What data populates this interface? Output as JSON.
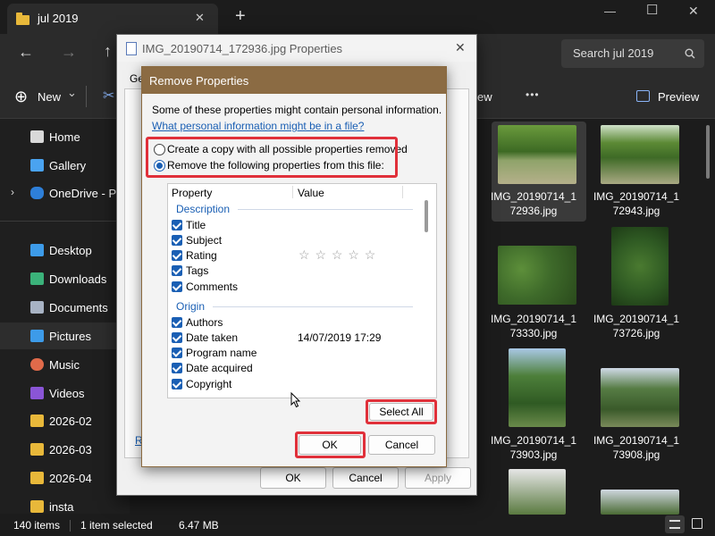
{
  "window": {
    "tab_title": "jul 2019",
    "new_tab": "+",
    "close_tab": "✕",
    "minimize": "—",
    "maximize": "☐",
    "close": "✕"
  },
  "address": {
    "back": "←",
    "forward": "→",
    "up": "↑",
    "search_placeholder": "Search jul 2019"
  },
  "toolbar": {
    "new_label": "New",
    "new_chevron": "⌄",
    "more": "•••",
    "preview_label": "Preview",
    "view_label": "ew"
  },
  "sidebar": {
    "items": [
      {
        "label": "Home",
        "color": "#d9d9d9"
      },
      {
        "label": "Gallery",
        "color": "#4aa3f0"
      },
      {
        "label": "OneDrive - Per",
        "color": "#2e7fd8"
      },
      {
        "label": "Desktop",
        "color": "#3d9be9"
      },
      {
        "label": "Downloads",
        "color": "#3bb27a"
      },
      {
        "label": "Documents",
        "color": "#a8b3c4"
      },
      {
        "label": "Pictures",
        "color": "#3d9be9"
      },
      {
        "label": "Music",
        "color": "#e06a4a"
      },
      {
        "label": "Videos",
        "color": "#8a55d6"
      },
      {
        "label": "2026-02",
        "color": "#e8b83a"
      },
      {
        "label": "2026-03",
        "color": "#e8b83a"
      },
      {
        "label": "2026-04",
        "color": "#e8b83a"
      },
      {
        "label": "insta",
        "color": "#e8b83a"
      }
    ]
  },
  "files": [
    {
      "line1": "IMG_20190714_1",
      "line2": "72936.jpg",
      "tone": "#4f7a2e"
    },
    {
      "line1": "IMG_20190714_1",
      "line2": "72943.jpg",
      "tone": "#5c8a35"
    },
    {
      "line1": "IMG_20190714_1",
      "line2": "73330.jpg",
      "tone": "#3e6a2a"
    },
    {
      "line1": "IMG_20190714_1",
      "line2": "73726.jpg",
      "tone": "#2f5a23"
    },
    {
      "line1": "IMG_20190714_1",
      "line2": "73903.jpg",
      "tone": "#4d7f3a"
    },
    {
      "line1": "IMG_20190714_1",
      "line2": "73908.jpg",
      "tone": "#567c44"
    }
  ],
  "status": {
    "items": "140 items",
    "selected": "1 item selected",
    "size": "6.47 MB"
  },
  "props_dialog": {
    "title": "IMG_20190714_172936.jpg Properties",
    "tab_partial": "Ge",
    "link_partial": "R",
    "ok": "OK",
    "cancel": "Cancel",
    "apply": "Apply"
  },
  "remove_dialog": {
    "title": "Remove Properties",
    "intro": "Some of these properties might contain personal information.",
    "link": "What personal information might be in a file?",
    "option_copy": "Create a copy with all possible properties removed",
    "option_remove": "Remove the following properties from this file:",
    "col_property": "Property",
    "col_value": "Value",
    "group_description": "Description",
    "group_origin": "Origin",
    "desc_rows": [
      "Title",
      "Subject",
      "Rating",
      "Tags",
      "Comments"
    ],
    "origin_rows": [
      "Authors",
      "Date taken",
      "Program name",
      "Date acquired",
      "Copyright"
    ],
    "rating_stars": "☆ ☆ ☆ ☆ ☆",
    "date_taken_value": "14/07/2019 17:29",
    "select_all": "Select All",
    "ok": "OK",
    "cancel": "Cancel"
  }
}
